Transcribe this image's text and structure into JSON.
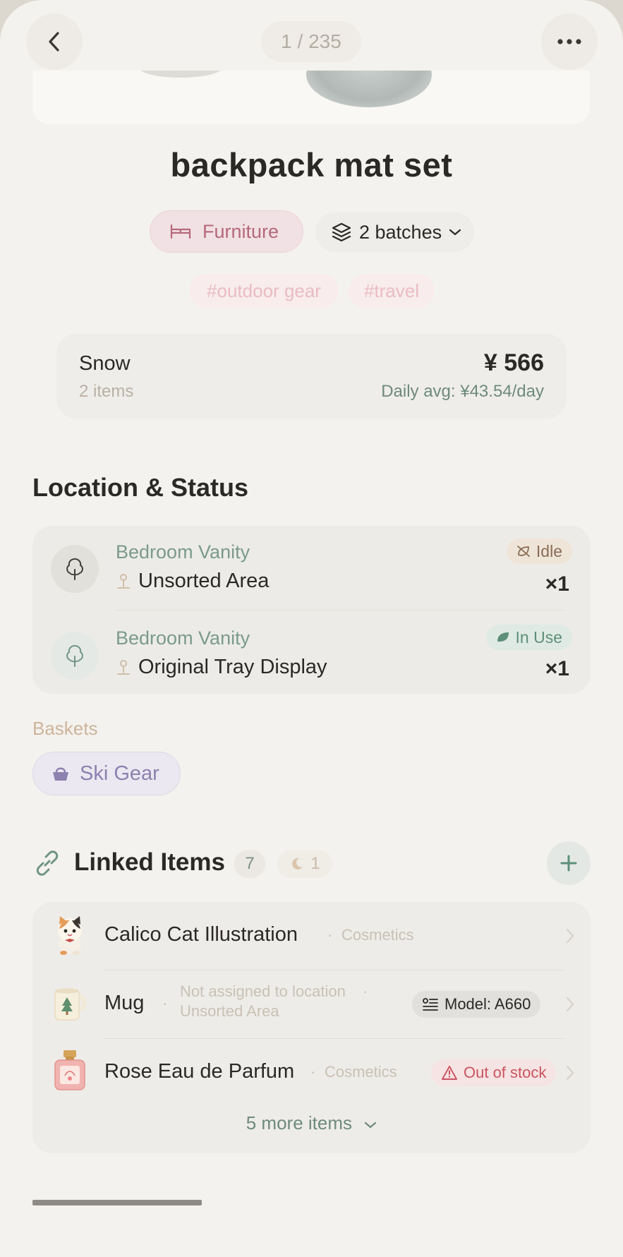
{
  "topbar": {
    "counter": "1 / 235"
  },
  "item": {
    "title": "backpack mat set",
    "category": "Furniture",
    "batches": "2 batches",
    "tags": [
      "#outdoor gear",
      "#travel"
    ]
  },
  "summary": {
    "name": "Snow",
    "count": "2 items",
    "price": "¥ 566",
    "daily_avg": "Daily avg: ¥43.54/day"
  },
  "location_section": {
    "title": "Location & Status",
    "entries": [
      {
        "area": "Bedroom Vanity",
        "spot": "Unsorted Area",
        "status": "Idle",
        "qty": "×1"
      },
      {
        "area": "Bedroom Vanity",
        "spot": "Original Tray Display",
        "status": "In Use",
        "qty": "×1"
      }
    ]
  },
  "baskets": {
    "label": "Baskets",
    "items": [
      "Ski Gear"
    ]
  },
  "linked": {
    "title": "Linked Items",
    "count": "7",
    "pending": "1",
    "items": [
      {
        "name": "Calico Cat Illustration",
        "sub": "Cosmetics",
        "badge": ""
      },
      {
        "name": "Mug",
        "sub_line1": "Not assigned to location",
        "sub_line2": "Unsorted Area",
        "badge": "Model: A660"
      },
      {
        "name": "Rose Eau de Parfum",
        "sub": "Cosmetics",
        "badge": "Out of stock"
      }
    ],
    "more": "5 more items"
  },
  "colors": {
    "background": "#f4f2ee",
    "category_pink": "#b6687b",
    "sage": "#7b9a8c",
    "idle": "#8a6d55",
    "in_use": "#5e8f7a",
    "out_of_stock": "#c9545f",
    "basket_purple": "#8d81b0"
  }
}
